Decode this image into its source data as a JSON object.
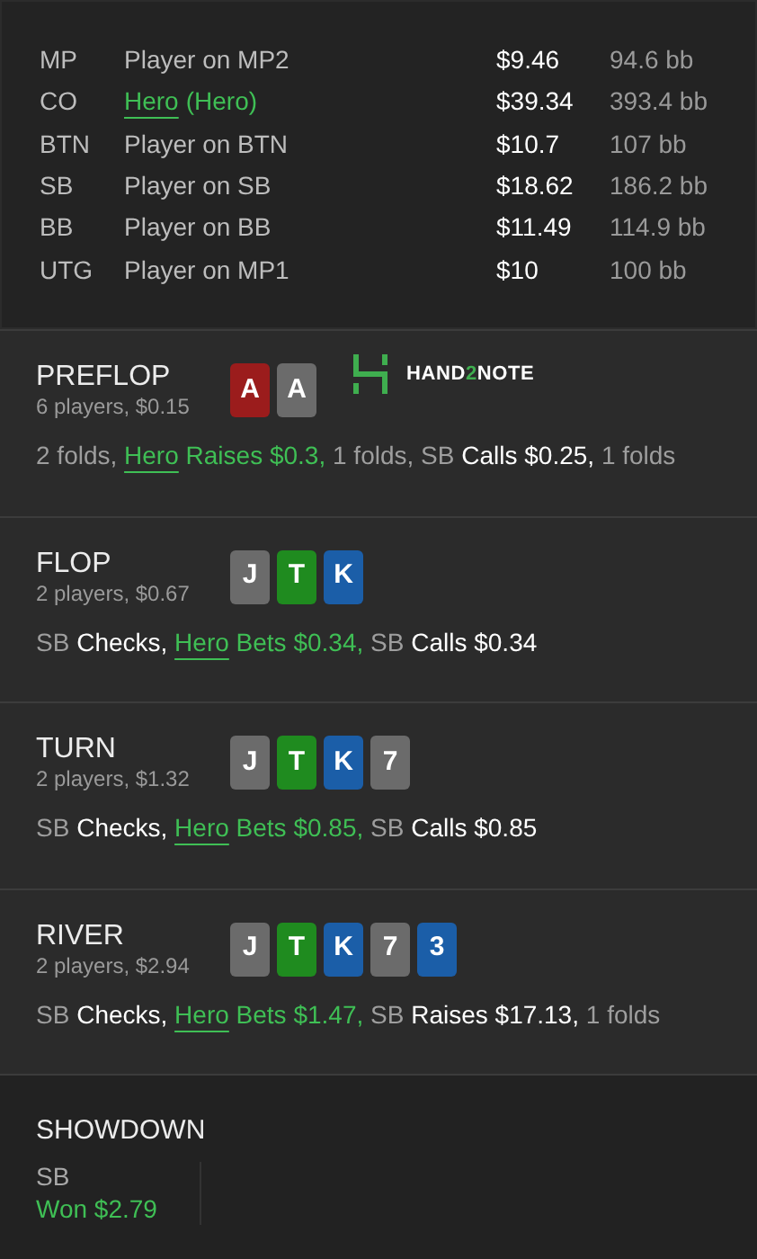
{
  "players": [
    {
      "position": "MP",
      "name": "Player on MP2",
      "is_hero": false,
      "stack": "$9.46",
      "bb": "94.6 bb"
    },
    {
      "position": "CO",
      "name": "Hero",
      "name_suffix": "(Hero)",
      "is_hero": true,
      "stack": "$39.34",
      "bb": "393.4 bb"
    },
    {
      "position": "BTN",
      "name": "Player on BTN",
      "is_hero": false,
      "stack": "$10.7",
      "bb": "107 bb"
    },
    {
      "position": "SB",
      "name": "Player on SB",
      "is_hero": false,
      "stack": "$18.62",
      "bb": "186.2 bb"
    },
    {
      "position": "BB",
      "name": "Player on BB",
      "is_hero": false,
      "stack": "$11.49",
      "bb": "114.9 bb"
    },
    {
      "position": "UTG",
      "name": "Player on MP1",
      "is_hero": false,
      "stack": "$10",
      "bb": "100 bb"
    }
  ],
  "streets": [
    {
      "title": "PREFLOP",
      "summary": "6 players, $0.15",
      "cards": [
        {
          "rank": "A",
          "color": "#9b1c1c"
        },
        {
          "rank": "A",
          "color": "#6b6b6b"
        }
      ],
      "logo": [
        {
          "text": "HAND",
          "accent": false
        },
        {
          "text": "2",
          "accent": true
        },
        {
          "text": "NOTE",
          "accent": false
        }
      ],
      "actions": [
        {
          "kind": "note",
          "text": "2 folds,"
        },
        {
          "kind": "hero",
          "player": "Hero",
          "text": "Raises $0.3,"
        },
        {
          "kind": "note",
          "text": "1 folds,"
        },
        {
          "kind": "villain",
          "player": "SB",
          "text": "Calls $0.25,"
        },
        {
          "kind": "note",
          "text": "1 folds"
        }
      ]
    },
    {
      "title": "FLOP",
      "summary": "2 players, $0.67",
      "cards": [
        {
          "rank": "J",
          "color": "#6b6b6b"
        },
        {
          "rank": "T",
          "color": "#1f8b1f"
        },
        {
          "rank": "K",
          "color": "#1b5ea8"
        }
      ],
      "actions": [
        {
          "kind": "villain",
          "player": "SB",
          "text": "Checks,"
        },
        {
          "kind": "hero",
          "player": "Hero",
          "text": "Bets $0.34,"
        },
        {
          "kind": "villain",
          "player": "SB",
          "text": "Calls $0.34"
        }
      ]
    },
    {
      "title": "TURN",
      "summary": "2 players, $1.32",
      "cards": [
        {
          "rank": "J",
          "color": "#6b6b6b"
        },
        {
          "rank": "T",
          "color": "#1f8b1f"
        },
        {
          "rank": "K",
          "color": "#1b5ea8"
        },
        {
          "rank": "7",
          "color": "#6b6b6b"
        }
      ],
      "actions": [
        {
          "kind": "villain",
          "player": "SB",
          "text": "Checks,"
        },
        {
          "kind": "hero",
          "player": "Hero",
          "text": "Bets $0.85,"
        },
        {
          "kind": "villain",
          "player": "SB",
          "text": "Calls $0.85"
        }
      ]
    },
    {
      "title": "RIVER",
      "summary": "2 players, $2.94",
      "cards": [
        {
          "rank": "J",
          "color": "#6b6b6b"
        },
        {
          "rank": "T",
          "color": "#1f8b1f"
        },
        {
          "rank": "K",
          "color": "#1b5ea8"
        },
        {
          "rank": "7",
          "color": "#6b6b6b"
        },
        {
          "rank": "3",
          "color": "#1b5ea8"
        }
      ],
      "actions": [
        {
          "kind": "villain",
          "player": "SB",
          "text": "Checks,"
        },
        {
          "kind": "hero",
          "player": "Hero",
          "text": "Bets $1.47,"
        },
        {
          "kind": "villain",
          "player": "SB",
          "text": "Raises $17.13,"
        },
        {
          "kind": "note",
          "text": "1 folds"
        }
      ]
    }
  ],
  "showdown": {
    "title": "SHOWDOWN",
    "results": [
      {
        "player": "SB",
        "outcome": "Won $2.79"
      }
    ]
  }
}
